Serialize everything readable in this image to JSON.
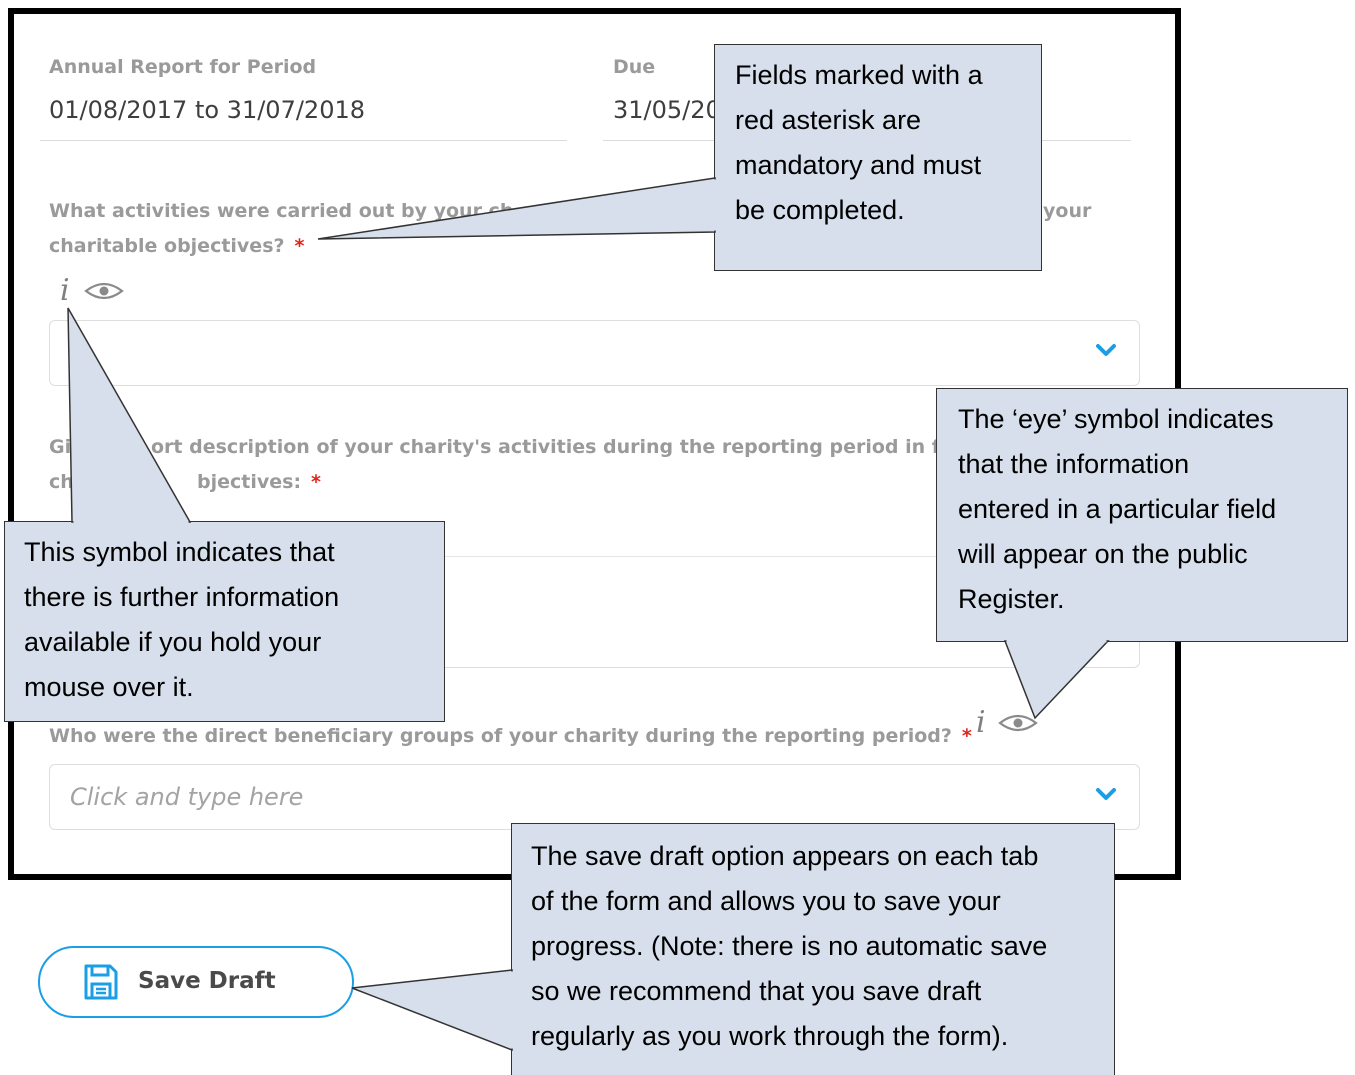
{
  "form": {
    "period_label": "Annual Report for Period",
    "period_value": "01/08/2017 to 31/07/2018",
    "due_label": "Due",
    "due_value_visible": "31/05/20",
    "q1_line1_visible": "What activities were carried out by your ch",
    "q1_line1_end": "your",
    "q1_line2": "charitable objectives?",
    "q2_line1_start": "Gi",
    "q2_line1_mid": "ort description of your charity's activities during the reporting period in fur",
    "q2_line2_start": "ch",
    "q2_line2_mid": "bjectives:",
    "q3_text": "Who were the direct beneficiary groups of your charity during the reporting period?",
    "required_mark": "*",
    "info_glyph": "i",
    "select_placeholder": "Click and type here",
    "save_draft_label": "Save Draft"
  },
  "callouts": {
    "mandatory": [
      "Fields marked with a",
      "red asterisk are",
      "mandatory and must",
      "be completed."
    ],
    "info_symbol": [
      "This symbol indicates that",
      "there is further information",
      "available if you hold your",
      "mouse over it."
    ],
    "eye_symbol": [
      "The ‘eye’ symbol indicates",
      "that the information",
      "entered in a particular field",
      "will appear on the public",
      "Register."
    ],
    "save_draft": [
      "The save draft option appears on each tab",
      "of the form and allows you to save your",
      "progress.  (Note: there is no automatic save",
      "so we recommend that you save draft",
      "regularly as you work through the form)."
    ]
  },
  "colors": {
    "required": "#e2231a",
    "accent_blue": "#1a9fe6",
    "callout_fill": "#d6dfeb"
  },
  "icons": [
    "info-icon",
    "eye-icon",
    "chevron-down-icon",
    "save-disk-icon"
  ]
}
